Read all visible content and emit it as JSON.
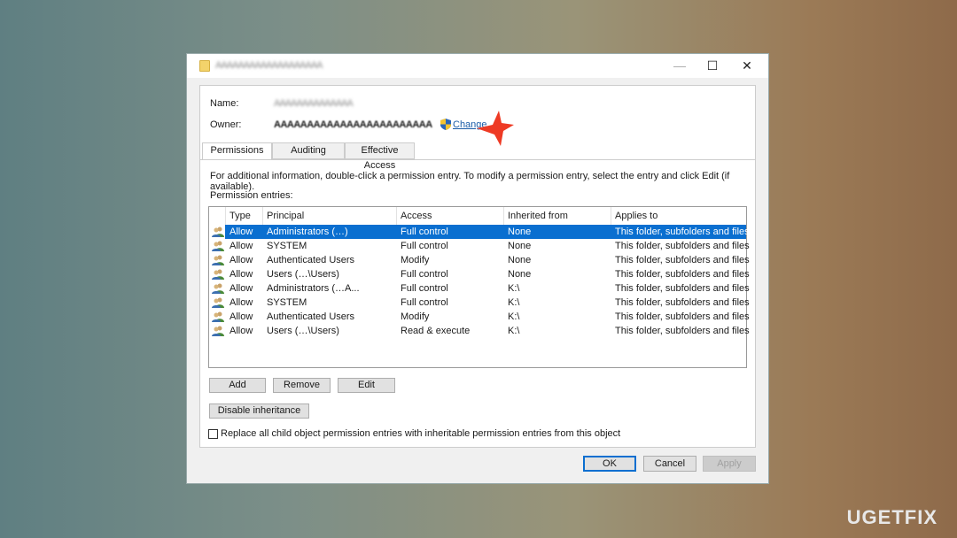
{
  "window": {
    "title": "AAAAAAAAAAAAAAAAAAA",
    "minimize": "—",
    "maximize": "☐",
    "close": "✕"
  },
  "header": {
    "name_label": "Name:",
    "name_value": "AAAAAAAAAAAAAA",
    "owner_label": "Owner:",
    "owner_value": "AAAAAAAAAAAAAAAAAAAAAAAA",
    "change_link": "Change"
  },
  "tabs": [
    {
      "label": "Permissions",
      "active": true
    },
    {
      "label": "Auditing"
    },
    {
      "label": "Effective Access"
    }
  ],
  "info_text": "For additional information, double-click a permission entry. To modify a permission entry, select the entry and click Edit (if available).",
  "entries_label": "Permission entries:",
  "columns": [
    "Type",
    "Principal",
    "Access",
    "Inherited from",
    "Applies to"
  ],
  "rows": [
    {
      "type": "Allow",
      "principal": "Administrators (…)",
      "access": "Full control",
      "inherited": "None",
      "applies": "This folder, subfolders and files",
      "selected": true
    },
    {
      "type": "Allow",
      "principal": "SYSTEM",
      "access": "Full control",
      "inherited": "None",
      "applies": "This folder, subfolders and files"
    },
    {
      "type": "Allow",
      "principal": "Authenticated Users",
      "access": "Modify",
      "inherited": "None",
      "applies": "This folder, subfolders and files"
    },
    {
      "type": "Allow",
      "principal": "Users (…\\Users)",
      "access": "Full control",
      "inherited": "None",
      "applies": "This folder, subfolders and files"
    },
    {
      "type": "Allow",
      "principal": "Administrators (…A...",
      "access": "Full control",
      "inherited": "K:\\",
      "applies": "This folder, subfolders and files"
    },
    {
      "type": "Allow",
      "principal": "SYSTEM",
      "access": "Full control",
      "inherited": "K:\\",
      "applies": "This folder, subfolders and files"
    },
    {
      "type": "Allow",
      "principal": "Authenticated Users",
      "access": "Modify",
      "inherited": "K:\\",
      "applies": "This folder, subfolders and files"
    },
    {
      "type": "Allow",
      "principal": "Users (…\\Users)",
      "access": "Read & execute",
      "inherited": "K:\\",
      "applies": "This folder, subfolders and files"
    }
  ],
  "buttons": {
    "add": "Add",
    "remove": "Remove",
    "edit": "Edit",
    "disable_inheritance": "Disable inheritance",
    "ok": "OK",
    "cancel": "Cancel",
    "apply": "Apply"
  },
  "replace_checkbox": {
    "label": "Replace all child object permission entries with inheritable permission entries from this object",
    "checked": false
  },
  "watermark": "UGETFIX",
  "colors": {
    "selection": "#0a6fd0",
    "star": "#ee3a24"
  }
}
